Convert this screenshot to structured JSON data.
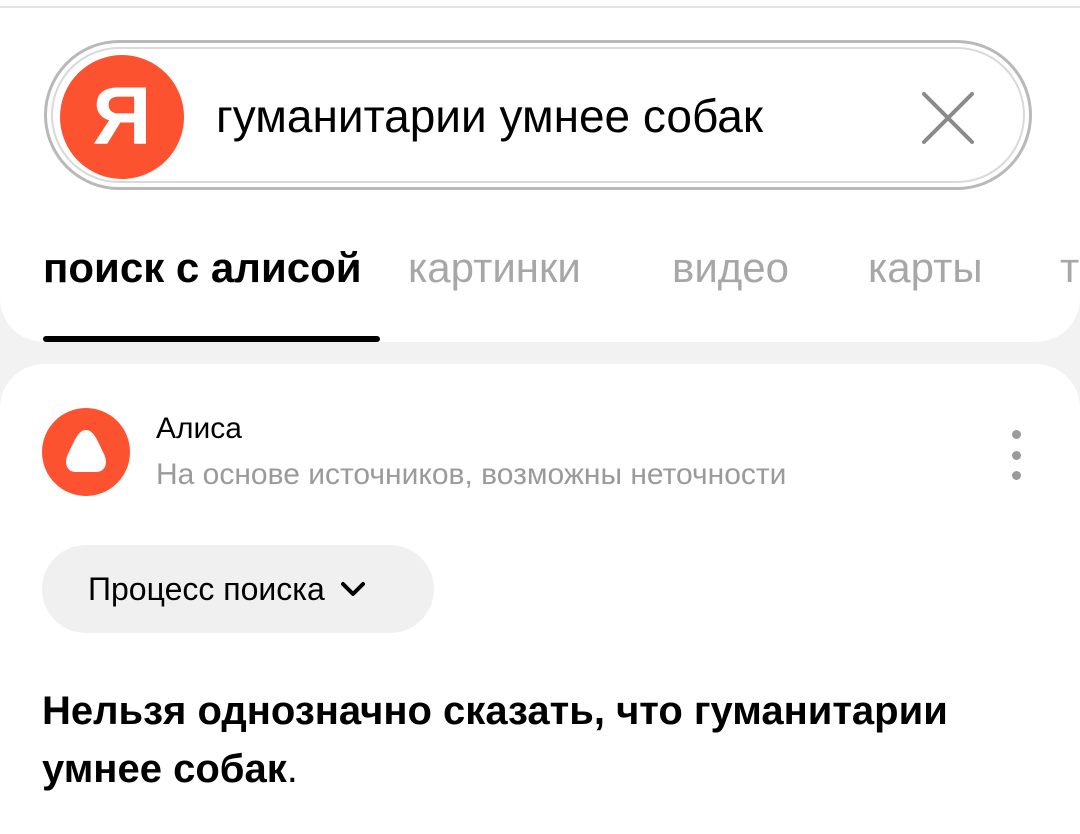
{
  "search": {
    "logo_letter": "Я",
    "query": "гуманитарии умнее собак",
    "clear_icon": "close-icon"
  },
  "tabs": [
    {
      "label": "поиск с алисой",
      "active": true
    },
    {
      "label": "картинки",
      "active": false
    },
    {
      "label": "видео",
      "active": false
    },
    {
      "label": "карты",
      "active": false
    },
    {
      "label": "т",
      "active": false
    }
  ],
  "answer": {
    "source_name": "Алиса",
    "source_note": "На основе источников, возможны неточности",
    "process_button": "Процесс поиска",
    "text": "Нельзя однозначно сказать, что гуманитарии умнее собак",
    "text_end": "."
  },
  "colors": {
    "brand": "#fc5230",
    "inactive_tab": "#a7a7a7",
    "muted_text": "#9a9a9a",
    "background": "#f2f2f2"
  }
}
